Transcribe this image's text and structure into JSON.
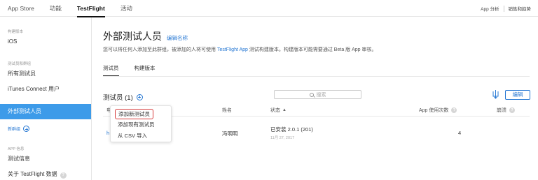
{
  "topbar": {
    "nav": [
      "App Store",
      "功能",
      "TestFlight",
      "活动"
    ],
    "active_nav": "TestFlight",
    "right_links": [
      "App 分析",
      "销售和趋势"
    ]
  },
  "sidebar": {
    "build_heading": "构建版本",
    "ios": "iOS",
    "testers_heading": "测试员和群组",
    "all_testers": "所有测试员",
    "itc_users": "iTunes Connect 用户",
    "external_group": "外部测试人员",
    "new_group": "新群组",
    "app_info_heading": "APP 信息",
    "test_info": "测试信息",
    "about": "关于 TestFlight 数据",
    "help_glyph": "?"
  },
  "main": {
    "title": "外部测试人员",
    "edit_name": "编辑名称",
    "desc_before": "您可以将任何人添加至此群组，被添加的人将可使用 ",
    "desc_link": "TestFlight App",
    "desc_after": " 测试构建版本。构建版本可能需要通过 Beta 版 App 审核。",
    "tabs": [
      "测试员",
      "构建版本"
    ],
    "section_title": "测试员 (1)",
    "search_placeholder": "搜索",
    "edit_button": "编辑",
    "columns": {
      "email": "电",
      "name": "姓名",
      "status": "状态",
      "sessions": "App 使用次数",
      "crashes": "崩溃"
    },
    "row": {
      "email": "h",
      "name": "冯明明",
      "status": "已安装 2.0.1 (201)",
      "date": "11月 27, 2017",
      "sessions": "4"
    }
  },
  "dropdown": {
    "items": [
      "添加新测试员",
      "添加现有测试员",
      "从 CSV 导入"
    ]
  },
  "colors": {
    "accent": "#2577d3",
    "sidebar_active": "#3d9be9",
    "highlight_border": "#d63a3a"
  }
}
